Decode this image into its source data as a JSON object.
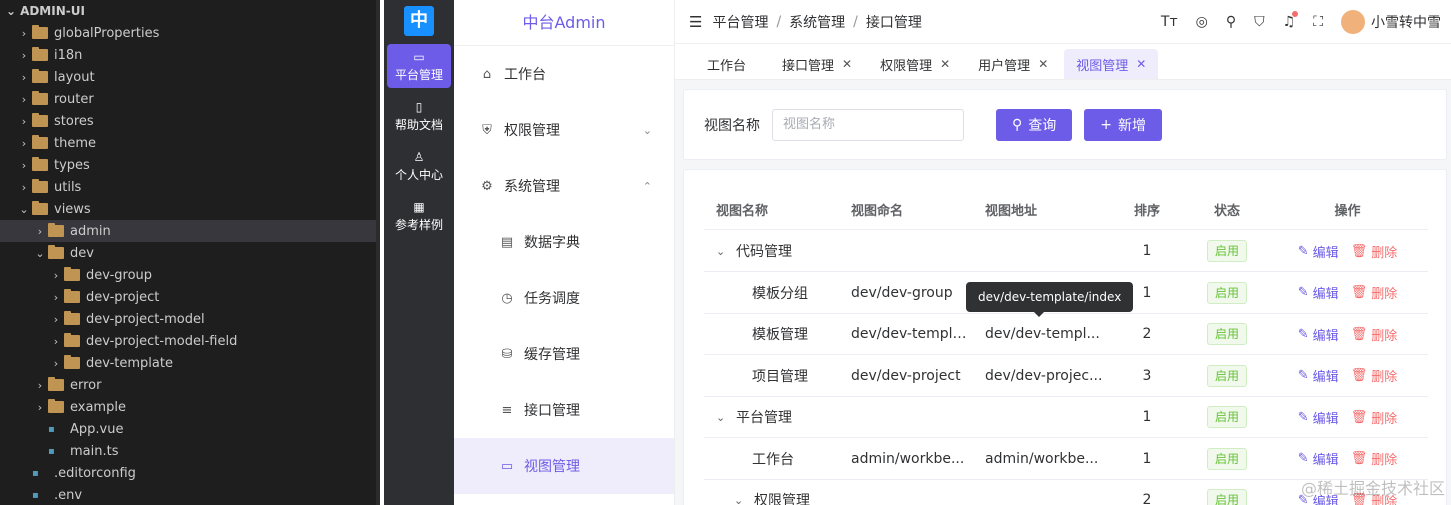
{
  "explorer": {
    "title": "ADMIN-UI",
    "items": [
      {
        "label": "globalProperties",
        "chev": "›",
        "depth": 1
      },
      {
        "label": "i18n",
        "chev": "›",
        "depth": 1
      },
      {
        "label": "layout",
        "chev": "›",
        "depth": 1
      },
      {
        "label": "router",
        "chev": "›",
        "depth": 1
      },
      {
        "label": "stores",
        "chev": "›",
        "depth": 1
      },
      {
        "label": "theme",
        "chev": "›",
        "depth": 1
      },
      {
        "label": "types",
        "chev": "›",
        "depth": 1
      },
      {
        "label": "utils",
        "chev": "›",
        "depth": 1
      },
      {
        "label": "views",
        "chev": "⌄",
        "depth": 1
      },
      {
        "label": "admin",
        "chev": "›",
        "depth": 2
      },
      {
        "label": "dev",
        "chev": "⌄",
        "depth": 2
      },
      {
        "label": "dev-group",
        "chev": "›",
        "depth": 3
      },
      {
        "label": "dev-project",
        "chev": "›",
        "depth": 3
      },
      {
        "label": "dev-project-model",
        "chev": "›",
        "depth": 3
      },
      {
        "label": "dev-project-model-field",
        "chev": "›",
        "depth": 3
      },
      {
        "label": "dev-template",
        "chev": "›",
        "depth": 3
      },
      {
        "label": "error",
        "chev": "›",
        "depth": 2
      },
      {
        "label": "example",
        "chev": "›",
        "depth": 2
      },
      {
        "label": "App.vue",
        "chev": "",
        "depth": 2
      },
      {
        "label": "main.ts",
        "chev": "",
        "depth": 2
      },
      {
        "label": ".editorconfig",
        "chev": "",
        "depth": 1
      },
      {
        "label": ".env",
        "chev": "",
        "depth": 1
      }
    ]
  },
  "rail": {
    "logo": "中",
    "items": [
      {
        "icon": "▭",
        "label": "平台管理"
      },
      {
        "icon": "▯",
        "label": "帮助文档"
      },
      {
        "icon": "♙",
        "label": "个人中心"
      },
      {
        "icon": "▦",
        "label": "参考样例"
      }
    ]
  },
  "menu": {
    "brand": "中台Admin",
    "items": [
      {
        "icon": "⌂",
        "label": "工作台",
        "arrow": ""
      },
      {
        "icon": "⛨",
        "label": "权限管理",
        "arrow": "⌄"
      },
      {
        "icon": "⚙",
        "label": "系统管理",
        "arrow": "⌃"
      },
      {
        "icon": "▤",
        "label": "数据字典",
        "arrow": ""
      },
      {
        "icon": "◷",
        "label": "任务调度",
        "arrow": ""
      },
      {
        "icon": "⛁",
        "label": "缓存管理",
        "arrow": ""
      },
      {
        "icon": "≡",
        "label": "接口管理",
        "arrow": ""
      },
      {
        "icon": "▭",
        "label": "视图管理",
        "arrow": ""
      }
    ]
  },
  "header": {
    "breadcrumb": [
      "平台管理",
      "系统管理",
      "接口管理"
    ],
    "user": "小雪转中雪"
  },
  "tabs": [
    {
      "label": "工作台",
      "close": ""
    },
    {
      "label": "接口管理",
      "close": "✕"
    },
    {
      "label": "权限管理",
      "close": "✕"
    },
    {
      "label": "用户管理",
      "close": "✕"
    },
    {
      "label": "视图管理",
      "close": "✕"
    }
  ],
  "search": {
    "label": "视图名称",
    "placeholder": "视图名称",
    "query": "查询",
    "add": "新增"
  },
  "table": {
    "headers": [
      "视图名称",
      "视图命名",
      "视图地址",
      "排序",
      "状态",
      "操作"
    ],
    "edit": "编辑",
    "delete": "删除",
    "rows": [
      {
        "name": "代码管理",
        "code": "",
        "path": "",
        "sort": "1",
        "status": "启用",
        "chev": "⌄"
      },
      {
        "name": "模板分组",
        "code": "dev/dev-group",
        "path": "",
        "sort": "1",
        "status": "启用",
        "chev": ""
      },
      {
        "name": "模板管理",
        "code": "dev/dev-template",
        "path": "dev/dev-templ...",
        "sort": "2",
        "status": "启用",
        "chev": ""
      },
      {
        "name": "项目管理",
        "code": "dev/dev-project",
        "path": "dev/dev-projec...",
        "sort": "3",
        "status": "启用",
        "chev": ""
      },
      {
        "name": "平台管理",
        "code": "",
        "path": "",
        "sort": "1",
        "status": "启用",
        "chev": "⌄"
      },
      {
        "name": "工作台",
        "code": "admin/workbe...",
        "path": "admin/workbe...",
        "sort": "1",
        "status": "启用",
        "chev": ""
      },
      {
        "name": "权限管理",
        "code": "",
        "path": "",
        "sort": "2",
        "status": "启用",
        "chev": "⌄"
      }
    ]
  },
  "tooltip": "dev/dev-template/index",
  "watermark": "@稀土掘金技术社区"
}
